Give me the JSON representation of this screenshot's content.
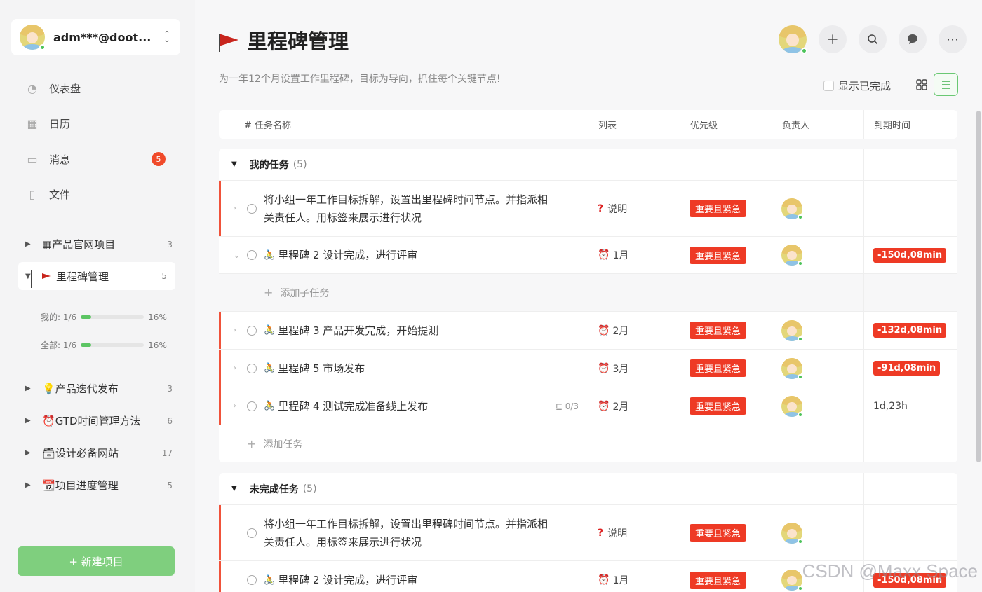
{
  "user": {
    "name": "adm***@doot..."
  },
  "nav": [
    {
      "label": "仪表盘",
      "icon": "dashboard-icon"
    },
    {
      "label": "日历",
      "icon": "calendar-icon"
    },
    {
      "label": "消息",
      "icon": "message-icon",
      "badge": "5"
    },
    {
      "label": "文件",
      "icon": "file-icon"
    }
  ],
  "projects": [
    {
      "label": "产品官网项目",
      "emoji": "▦",
      "count": "3"
    },
    {
      "label": "里程碑管理",
      "count": "5"
    },
    {
      "label": "产品迭代发布",
      "emoji": "💡",
      "count": "3"
    },
    {
      "label": "GTD时间管理方法",
      "emoji": "⏰",
      "count": "6"
    },
    {
      "label": "设计必备网站",
      "emoji": "🗃",
      "count": "17"
    },
    {
      "label": "项目进度管理",
      "emoji": "📆",
      "count": "5"
    }
  ],
  "progress": [
    {
      "label": "我的: 1/6",
      "percent": "16%",
      "value": 0.16
    },
    {
      "label": "全部: 1/6",
      "percent": "16%",
      "value": 0.16
    }
  ],
  "new_project": "+ 新建项目",
  "page": {
    "title": "里程碑管理",
    "subtitle": "为一年12个月设置工作里程碑，目标为导向，抓住每个关键节点!",
    "show_done": "显示已完成"
  },
  "columns": [
    "# 任务名称",
    "列表",
    "优先级",
    "负责人",
    "到期时间"
  ],
  "groups": [
    {
      "title": "我的任务",
      "count": "(5)",
      "tasks": [
        {
          "name1": "将小组一年工作目标拆解，设置出里程碑时间节点。并指派相",
          "name2": "关责任人。用标签来展示进行状况",
          "list": "说明",
          "priority": "重要且紧急",
          "due": ""
        },
        {
          "name": "里程碑 2 设计完成，进行评审",
          "list": "1月",
          "priority": "重要且紧急",
          "due": "-150d,08min"
        },
        {
          "name": "里程碑 3 产品开发完成，开始提测",
          "list": "2月",
          "priority": "重要且紧急",
          "due": "-132d,08min"
        },
        {
          "name": "里程碑 5 市场发布",
          "list": "3月",
          "priority": "重要且紧急",
          "due": "-91d,08min"
        },
        {
          "name": "里程碑 4 测试完成准备线上发布",
          "subcount": "0/3",
          "list": "2月",
          "priority": "重要且紧急",
          "due": "1d,23h"
        }
      ],
      "add_subtask": "添加子任务",
      "add_task": "添加任务"
    },
    {
      "title": "未完成任务",
      "count": "(5)",
      "tasks": [
        {
          "name1": "将小组一年工作目标拆解，设置出里程碑时间节点。并指派相",
          "name2": "关责任人。用标签来展示进行状况",
          "list": "说明",
          "priority": "重要且紧急"
        },
        {
          "name": "里程碑 2 设计完成，进行评审",
          "list": "1月",
          "priority": "重要且紧急",
          "due": "-150d,08min"
        }
      ]
    }
  ],
  "watermark": "CSDN @Maxx Space",
  "colors": {
    "accent_green": "#7fcf7e",
    "urgent_red": "#ee3a25",
    "flag_red": "#c8251d"
  }
}
